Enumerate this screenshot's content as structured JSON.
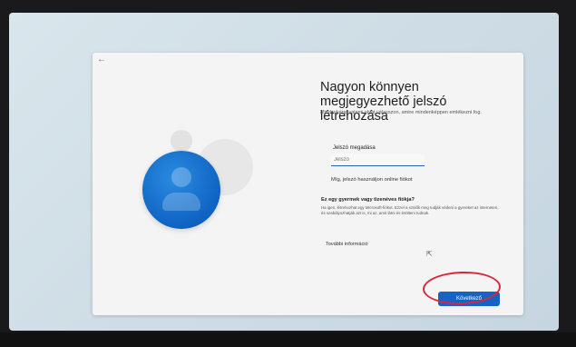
{
  "page": {
    "back_arrow": "←",
    "title": "Nagyon könnyen megjegyezhető jelszó létrehozása",
    "subtitle": "Mindenképp valami olyat válasszon, amire mindenképpen emlékezni fog.",
    "password": {
      "label": "Jelszó megadása",
      "placeholder": "Jelszó"
    },
    "alt_link": "Míg, jelszó használjon online fiókot",
    "child_section": {
      "heading": "Ez egy gyermek vagy tizenéves fiókja?",
      "text": "Ha igen, létrehozhat egy Microsoft-fiókot. Ezzel a szülők meg tudják védeni a gyereket az interneten, és szabályozhatják azt is, mi az, amit látni és letölteni tudnak."
    },
    "more_info": "További információ",
    "next_button": "Következő"
  },
  "taskbar": {
    "network_icon": "wifi-icon",
    "volume_icon": "volume-icon"
  },
  "colors": {
    "accent": "#1563c4",
    "annotation": "#d9273a"
  }
}
